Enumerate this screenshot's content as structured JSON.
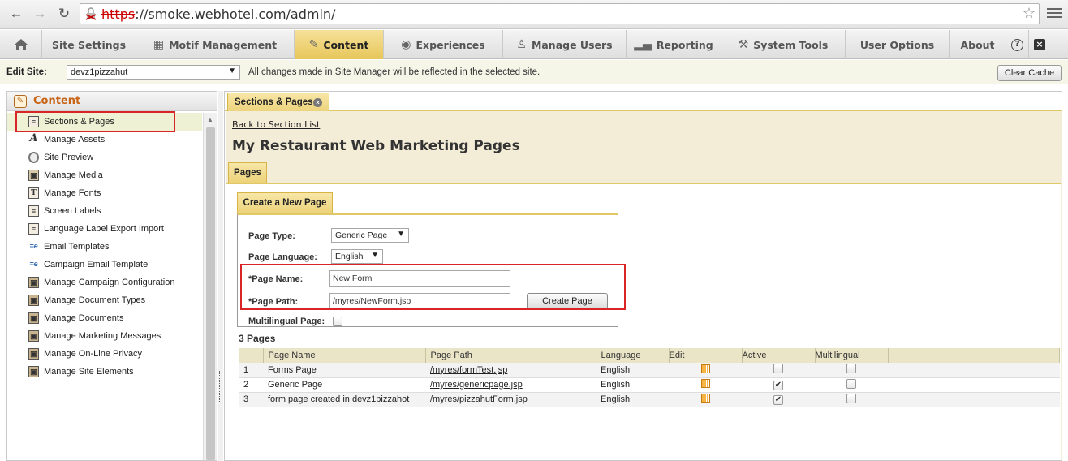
{
  "browser": {
    "url_scheme": "https",
    "url_rest": "://smoke.webhotel.com/admin/"
  },
  "nav": {
    "tabs": [
      {
        "label": "",
        "icon": "home-icon"
      },
      {
        "label": "Site Settings",
        "icon": ""
      },
      {
        "label": "Motif Management",
        "icon": "motif-icon"
      },
      {
        "label": "Content",
        "icon": "content-icon"
      },
      {
        "label": "Experiences",
        "icon": "globe-icon"
      },
      {
        "label": "Manage Users",
        "icon": "users-icon"
      },
      {
        "label": "Reporting",
        "icon": "chart-icon"
      },
      {
        "label": "System Tools",
        "icon": "tools-icon"
      },
      {
        "label": "User Options",
        "icon": ""
      },
      {
        "label": "About",
        "icon": ""
      },
      {
        "label": "?",
        "icon": "help-icon"
      }
    ],
    "active": "Content"
  },
  "edit_bar": {
    "label": "Edit Site:",
    "site": "devz1pizzahut",
    "note": "All changes made in Site Manager will be reflected in the selected site.",
    "clear_cache": "Clear Cache"
  },
  "sidebar": {
    "title": "Content",
    "items": [
      {
        "label": "Sections & Pages",
        "icon": "page-icon"
      },
      {
        "label": "Manage Assets",
        "icon": "font-a-icon"
      },
      {
        "label": "Site Preview",
        "icon": "magnifier-icon"
      },
      {
        "label": "Manage Media",
        "icon": "media-icon"
      },
      {
        "label": "Manage Fonts",
        "icon": "font-t-icon"
      },
      {
        "label": "Screen Labels",
        "icon": "label-icon"
      },
      {
        "label": "Language Label Export Import",
        "icon": "export-icon"
      },
      {
        "label": "Email Templates",
        "icon": "email-icon"
      },
      {
        "label": "Campaign Email Template",
        "icon": "email-icon"
      },
      {
        "label": "Manage Campaign Configuration",
        "icon": "config-icon"
      },
      {
        "label": "Manage Document Types",
        "icon": "doc-type-icon"
      },
      {
        "label": "Manage Documents",
        "icon": "docs-icon"
      },
      {
        "label": "Manage Marketing Messages",
        "icon": "message-icon"
      },
      {
        "label": "Manage On-Line Privacy",
        "icon": "privacy-icon"
      },
      {
        "label": "Manage Site Elements",
        "icon": "elements-icon"
      }
    ]
  },
  "main": {
    "tab_label": "Sections & Pages",
    "back_link": "Back to Section List",
    "title": "My Restaurant Web Marketing Pages",
    "pages_tab": "Pages",
    "new_page_tab": "Create a New Page",
    "form": {
      "page_type_label": "Page Type:",
      "page_type_value": "Generic Page",
      "page_language_label": "Page Language:",
      "page_language_value": "English",
      "page_name_label": "*Page Name:",
      "page_name_value": "New Form",
      "page_path_label": "*Page Path:",
      "page_path_value": "/myres/NewForm.jsp",
      "create_button": "Create Page",
      "multilingual_label": "Multilingual Page:"
    },
    "pages_count": "3 Pages",
    "table": {
      "headers": [
        "Page Name",
        "Page Path",
        "Language",
        "Edit",
        "Active",
        "Multilingual"
      ],
      "rows": [
        {
          "num": "1",
          "name": "Forms Page",
          "path": "/myres/formTest.jsp",
          "language": "English",
          "active": false,
          "multilingual": false
        },
        {
          "num": "2",
          "name": "Generic Page",
          "path": "/myres/genericpage.jsp",
          "language": "English",
          "active": true,
          "multilingual": false
        },
        {
          "num": "3",
          "name": "form page created in devz1pizzahot",
          "path": "/myres/pizzahutForm.jsp",
          "language": "English",
          "active": true,
          "multilingual": false
        }
      ]
    }
  }
}
